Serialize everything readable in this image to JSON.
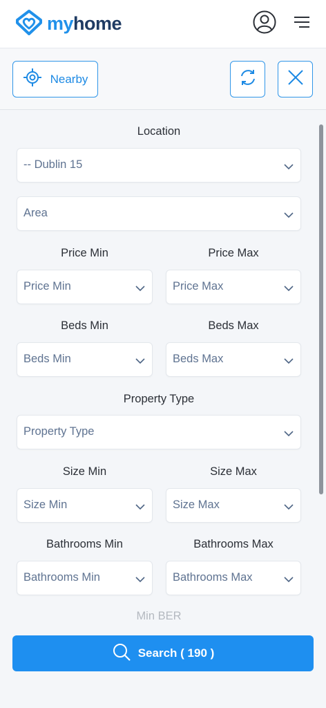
{
  "header": {
    "logo_my": "my",
    "logo_home": "home"
  },
  "toolbar": {
    "nearby_label": "Nearby"
  },
  "form": {
    "location_label": "Location",
    "location_value": "-- Dublin 15",
    "area_value": "Area",
    "price_min_label": "Price Min",
    "price_max_label": "Price Max",
    "price_min_value": "Price Min",
    "price_max_value": "Price Max",
    "beds_min_label": "Beds Min",
    "beds_max_label": "Beds Max",
    "beds_min_value": "Beds Min",
    "beds_max_value": "Beds Max",
    "property_type_label": "Property Type",
    "property_type_value": "Property Type",
    "size_min_label": "Size Min",
    "size_max_label": "Size Max",
    "size_min_value": "Size Min",
    "size_max_value": "Size Max",
    "bathrooms_min_label": "Bathrooms Min",
    "bathrooms_max_label": "Bathrooms Max",
    "bathrooms_min_value": "Bathrooms Min",
    "bathrooms_max_value": "Bathrooms Max",
    "min_ber_label": "Min BER"
  },
  "search": {
    "label": "Search ( 190 )"
  },
  "colors": {
    "accent": "#1e8ff0",
    "logo_blue": "#2191ea",
    "logo_navy": "#1f3b63",
    "placeholder": "#5f7391"
  },
  "icons": [
    "home-heart-logo-icon",
    "user-icon",
    "menu-icon",
    "target-icon",
    "refresh-icon",
    "close-icon",
    "chevron-down-icon",
    "search-icon"
  ]
}
